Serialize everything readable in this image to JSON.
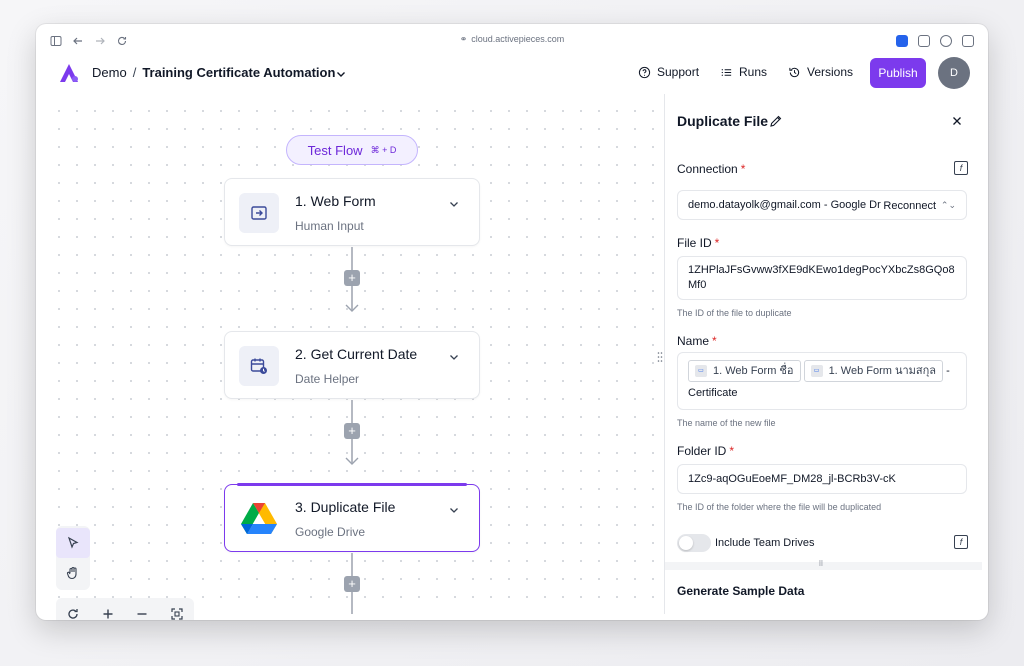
{
  "browser": {
    "url": "cloud.activepieces.com"
  },
  "header": {
    "project": "Demo",
    "separator": "/",
    "flow_name": "Training Certificate Automation",
    "support_label": "Support",
    "runs_label": "Runs",
    "versions_label": "Versions",
    "publish_label": "Publish",
    "avatar_initial": "D"
  },
  "canvas": {
    "test_flow_label": "Test Flow",
    "test_flow_shortcut": "⌘ + D",
    "steps": [
      {
        "title": "1. Web Form",
        "subtitle": "Human Input",
        "icon": "form-input-icon"
      },
      {
        "title": "2. Get Current Date",
        "subtitle": "Date Helper",
        "icon": "calendar-clock-icon"
      },
      {
        "title": "3. Duplicate File",
        "subtitle": "Google Drive",
        "icon": "google-drive-icon"
      }
    ],
    "add_symbol": "+"
  },
  "panel": {
    "title": "Duplicate File",
    "connection_label": "Connection",
    "connection_value": "demo.datayolk@gmail.com - Google Dr",
    "reconnect_label": "Reconnect",
    "file_id_label": "File ID",
    "file_id_value": "1ZHPlaJFsGvww3fXE9dKEwo1degPocYXbcZs8GQo8Mf0",
    "file_id_help": "The ID of the file to duplicate",
    "name_label": "Name",
    "name_chip_1": "1. Web Form ชื่อ",
    "name_chip_2": "1. Web Form นามสกุล",
    "name_dash": "-",
    "name_suffix": "Certificate",
    "name_help": "The name of the new file",
    "folder_id_label": "Folder ID",
    "folder_id_value": "1Zc9-aqOGuEoeMF_DM28_jl-BCRb3V-cK",
    "folder_id_help": "The ID of the folder where the file will be duplicated",
    "include_team_drives_label": "Include Team Drives",
    "required_mark": "*",
    "fx_symbol": "f",
    "generate_sample_label": "Generate Sample Data"
  },
  "colors": {
    "accent": "#7c3aed",
    "required": "#dc2626"
  }
}
